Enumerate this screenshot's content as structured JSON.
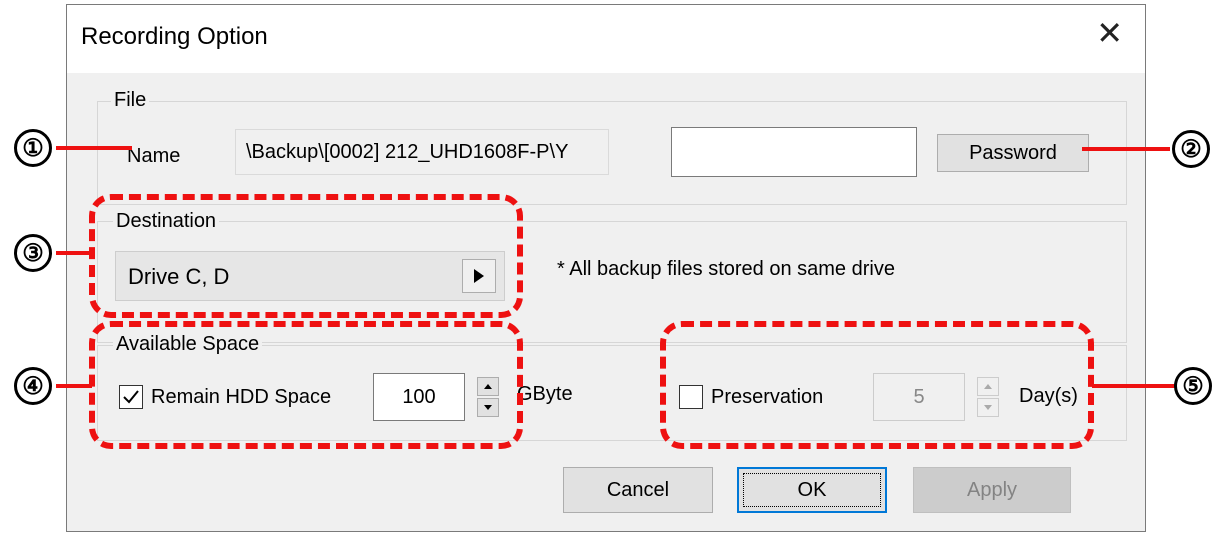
{
  "dialog": {
    "title": "Recording Option"
  },
  "file_group": {
    "label": "File",
    "name_label": "Name",
    "name_value": "\\Backup\\[0002] 212_UHD1608F-P\\Y",
    "password_value": "",
    "password_button": "Password"
  },
  "destination_group": {
    "label": "Destination",
    "value": "Drive C, D",
    "note": "* All backup files stored on same drive"
  },
  "space_group": {
    "label": "Available Space",
    "remain_label": "Remain HDD Space",
    "remain_checked": true,
    "remain_value": "100",
    "unit": "GByte",
    "preservation_label": "Preservation",
    "preservation_checked": false,
    "preservation_value": "5",
    "preservation_unit": "Day(s)"
  },
  "buttons": {
    "cancel": "Cancel",
    "ok": "OK",
    "apply": "Apply"
  },
  "callouts": [
    "①",
    "②",
    "③",
    "④",
    "⑤"
  ],
  "colors": {
    "highlight": "#ee1111",
    "accent": "#0078d7"
  },
  "icons": {
    "close": "close-icon",
    "arrow": "play-arrow-icon",
    "check": "checkmark-icon"
  }
}
